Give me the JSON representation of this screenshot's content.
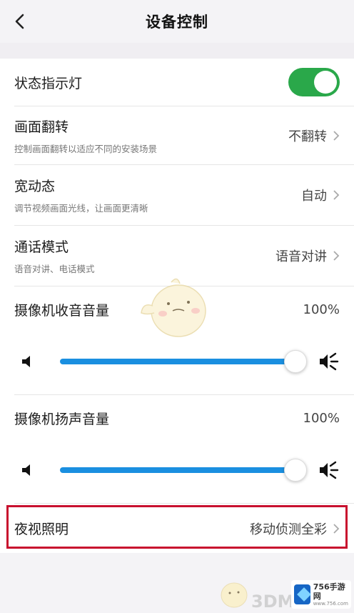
{
  "header": {
    "title": "设备控制"
  },
  "settings": {
    "status_light": {
      "label": "状态指示灯",
      "enabled": true,
      "accent": "#2aa84a"
    },
    "flip": {
      "label": "画面翻转",
      "subtitle": "控制画面翻转以适应不同的安装场景",
      "value": "不翻转"
    },
    "wdr": {
      "label": "宽动态",
      "subtitle": "调节视频画面光线，让画面更清晰",
      "value": "自动"
    },
    "call_mode": {
      "label": "通话模式",
      "subtitle": "语音对讲、电话模式",
      "value": "语音对讲"
    },
    "mic_volume": {
      "label": "摄像机收音音量",
      "value": "100%",
      "level": 1.0
    },
    "speaker_volume": {
      "label": "摄像机扬声音量",
      "value": "100%",
      "level": 1.0
    },
    "night_vision": {
      "label": "夜视照明",
      "value": "移动侦测全彩"
    }
  },
  "watermark": {
    "text": "3DM",
    "logo_line1": "756手游网",
    "logo_line2": "www.756.com"
  },
  "colors": {
    "slider": "#1a8fe0",
    "highlight": "#c8102e"
  }
}
